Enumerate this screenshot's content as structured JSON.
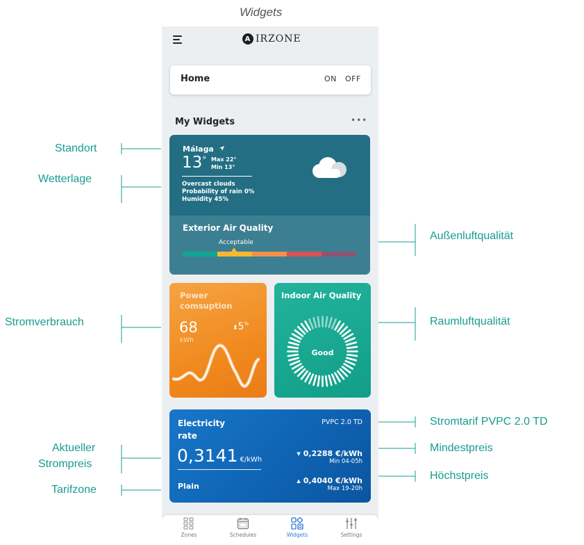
{
  "caption": "Widgets",
  "app": {
    "logo_letter": "A",
    "logo_text": "IRZONE"
  },
  "home": {
    "title": "Home",
    "on": "ON",
    "off": "OFF"
  },
  "widgets_header": {
    "title": "My Widgets",
    "more": "•••"
  },
  "weather": {
    "city": "Málaga",
    "temp": "13",
    "temp_unit": "°",
    "max": "Max 22°",
    "min": "Min 13°",
    "conditions": "Overcast clouds",
    "rain": "Probability of rain 0%",
    "humidity": "Humidity 45%",
    "aq_title": "Exterior Air Quality",
    "aq_value": "Acceptable",
    "aq_scale_colors": [
      "#13a394",
      "#f7b733",
      "#f0924a",
      "#d75356",
      "#8e5573"
    ]
  },
  "power": {
    "title_line1": "Power",
    "title_line2": "comsuption",
    "value": "68",
    "unit": "kWh",
    "change": "5",
    "change_unit": "%"
  },
  "indoor": {
    "title": "Indoor Air Quality",
    "value": "Good"
  },
  "electricity": {
    "title_line1": "Electricity",
    "title_line2": "rate",
    "tariff": "PVPC 2.0 TD",
    "price": "0,3141",
    "price_unit": "€/kWh",
    "zone": "Plain",
    "min_price": "0,2288 €/kWh",
    "min_label": "Min 04-05h",
    "max_price": "0,4040 €/kWh",
    "max_label": "Max 19-20h"
  },
  "tabs": [
    {
      "label": "Zones",
      "icon": "zones-grid-icon"
    },
    {
      "label": "Schedules",
      "icon": "calendar-icon"
    },
    {
      "label": "Widgets",
      "icon": "widgets-icon"
    },
    {
      "label": "Settings",
      "icon": "sliders-icon"
    }
  ],
  "annotations": {
    "standort": "Standort",
    "wetterlage": "Wetterlage",
    "stromverbrauch": "Stromverbrauch",
    "aktueller_line1": "Aktueller",
    "aktueller_line2": "Strompreis",
    "tarifzone": "Tarifzone",
    "aussenluft": "Außenluftqualität",
    "raumluft": "Raumluftqualität",
    "stromtarif": "Stromtarif PVPC 2.0 TD",
    "mindestpreis": "Mindestpreis",
    "hoechstpreis": "Höchstpreis"
  },
  "colors": {
    "accent": "#179c90",
    "weather": "#236e83",
    "power": "#f08a1f",
    "indoor": "#129e88",
    "electricity": "#0f64b3",
    "active_tab": "#2a77d4"
  }
}
